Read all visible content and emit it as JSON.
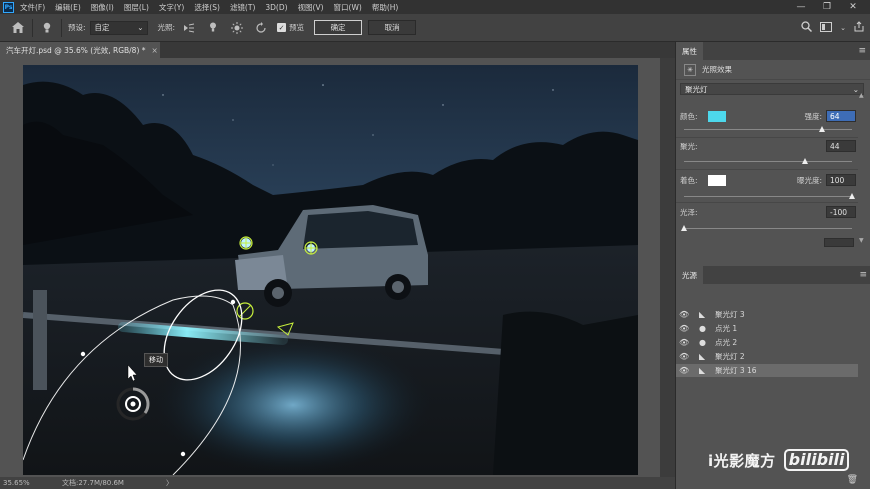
{
  "menubar": {
    "logo": "Ps",
    "items": [
      "文件(F)",
      "编辑(E)",
      "图像(I)",
      "图层(L)",
      "文字(Y)",
      "选择(S)",
      "滤镜(T)",
      "3D(D)",
      "视图(V)",
      "窗口(W)",
      "帮助(H)"
    ],
    "window_controls": [
      "—",
      "❐",
      "✕"
    ]
  },
  "options": {
    "preset_label": "预设:",
    "preset_value": "自定",
    "light_label": "光照:",
    "preview_label": "预览",
    "ok_label": "确定",
    "cancel_label": "取消"
  },
  "document": {
    "tab_title": "汽车开灯.psd @ 35.6% (光效, RGB/8) *",
    "close": "×"
  },
  "canvas": {
    "tooltip": "移动"
  },
  "status": {
    "zoom": "35.65%",
    "doc_size": "文档:27.7M/80.6M",
    "arrow": "〉"
  },
  "properties": {
    "tab_label": "属性",
    "header_label": "光照效果",
    "light_type": "聚光灯",
    "color_label": "颜色:",
    "color_value": "#4dd8ec",
    "intensity_label": "强度:",
    "intensity_value": "64",
    "intensity_fraction": 0.82,
    "hotspot_label": "聚光:",
    "hotspot_value": "44",
    "hotspot_fraction": 0.72,
    "colorize_label": "着色:",
    "colorize_value": "#ffffff",
    "exposure_label": "曝光度:",
    "exposure_value": "100",
    "exposure_fraction": 1.0,
    "gloss_label": "光泽:",
    "gloss_value": "-100",
    "gloss_fraction": 0.0
  },
  "lights": {
    "tab_label": "光源",
    "items": [
      {
        "name": "聚光灯 3",
        "type": "spot"
      },
      {
        "name": "点光 1",
        "type": "point"
      },
      {
        "name": "点光 2",
        "type": "point"
      },
      {
        "name": "聚光灯 2",
        "type": "spot"
      },
      {
        "name": "聚光灯 3 16",
        "type": "spot",
        "selected": true
      }
    ]
  },
  "watermark": {
    "text": "i光影魔方",
    "logo": "bilibili"
  }
}
